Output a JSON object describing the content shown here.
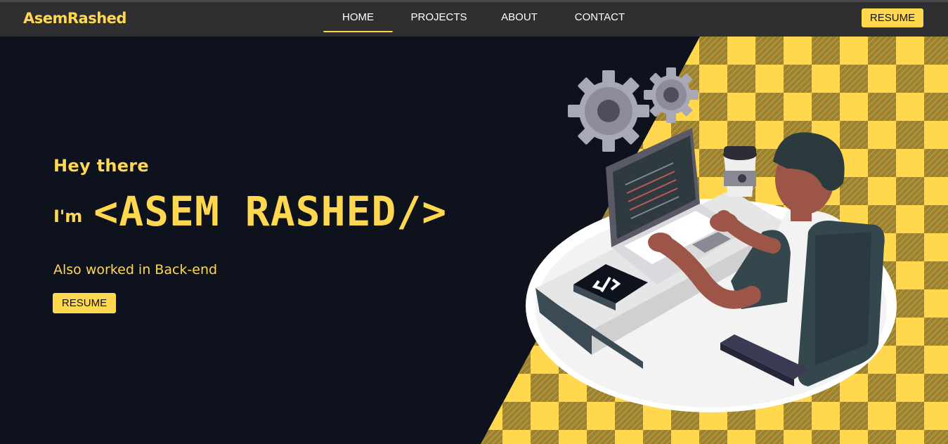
{
  "nav": {
    "brand": "AsemRashed",
    "links": [
      {
        "label": "HOME",
        "active": true
      },
      {
        "label": "PROJECTS",
        "active": false
      },
      {
        "label": "ABOUT",
        "active": false
      },
      {
        "label": "CONTACT",
        "active": false
      }
    ],
    "resume_label": "RESUME"
  },
  "hero": {
    "greeting": "Hey there",
    "intro_prefix": "I'm",
    "name": "<ASEM RASHED/>",
    "tagline": "Also worked in Back-end",
    "resume_label": "RESUME"
  },
  "colors": {
    "accent": "#ffd84f",
    "background": "#0d121d",
    "navbar": "#2f2f31",
    "checker_dark": "#9b8232"
  },
  "illustration": {
    "subject": "developer-at-laptop",
    "icons": [
      "gear-icon",
      "gear-icon",
      "coffee-cup-icon",
      "code-book-icon"
    ]
  }
}
